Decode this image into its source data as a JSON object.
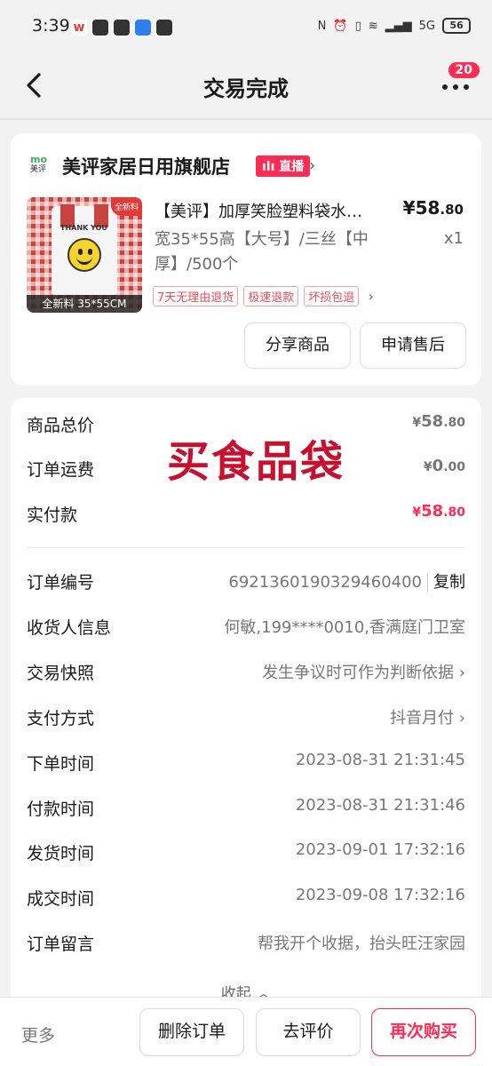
{
  "status_bar": {
    "time": "3:39",
    "battery": "56",
    "network": "5G"
  },
  "nav": {
    "title": "交易完成",
    "badge": "20"
  },
  "shop": {
    "logo_line1": "mo",
    "logo_line2": "美评",
    "name": "美评家居日用旗舰店",
    "live_tag": "直播"
  },
  "product": {
    "title": "【美评】加厚笑脸塑料袋水…",
    "price_symbol": "¥",
    "price_int": "58",
    "price_dec": ".80",
    "spec": "宽35*55高【大号】/三丝【中厚】/500个",
    "qty": "x1",
    "img_caption": "全新料 35*55CM",
    "img_corner_tag": "全新料",
    "img_bag_text": "THANK YOU",
    "tags": [
      "7天无理由退货",
      "极速退款",
      "坏损包退"
    ],
    "share_btn": "分享商品",
    "after_sale_btn": "申请售后"
  },
  "summary": {
    "stamp_text": "买食品袋",
    "rows": [
      {
        "label": "商品总价",
        "cur": "¥",
        "int": "58",
        "dec": ".80"
      },
      {
        "label": "订单运费",
        "cur": "¥",
        "int": "0",
        "dec": ".00"
      },
      {
        "label": "实付款",
        "cur": "¥",
        "int": "58",
        "dec": ".80"
      }
    ]
  },
  "details": {
    "order_no_label": "订单编号",
    "order_no": "6921360190329460400",
    "copy_label": "复制",
    "receiver_label": "收货人信息",
    "receiver": "何敏,199****0010,香满庭门卫室",
    "snapshot_label": "交易快照",
    "snapshot": "发生争议时可作为判断依据",
    "payment_label": "支付方式",
    "payment": "抖音月付",
    "order_time_label": "下单时间",
    "order_time": "2023-08-31 21:31:45",
    "pay_time_label": "付款时间",
    "pay_time": "2023-08-31 21:31:46",
    "ship_time_label": "发货时间",
    "ship_time": "2023-09-01 17:32:16",
    "deal_time_label": "成交时间",
    "deal_time": "2023-09-08 17:32:16",
    "note_label": "订单留言",
    "note": "帮我开个收据，抬头旺汪家园",
    "collapse": "收起"
  },
  "bottom": {
    "more": "更多",
    "delete": "删除订单",
    "review": "去评价",
    "rebuy": "再次购买"
  },
  "colors": {
    "accent": "#fe2c55",
    "stamp": "#c8102e",
    "page_bg": "#f2f2f2"
  }
}
